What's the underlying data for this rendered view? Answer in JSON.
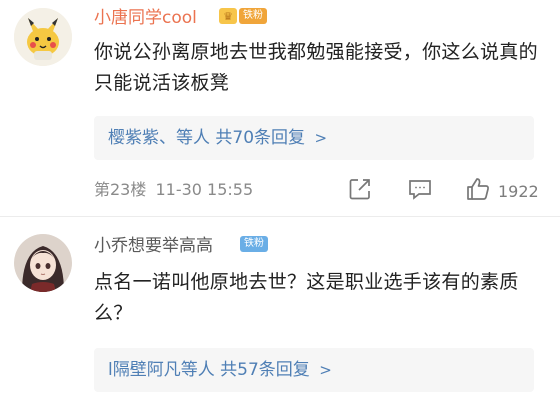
{
  "comments": [
    {
      "username": "小唐同学cool",
      "badge": "铁粉",
      "text": "你说公孙离原地去世我都勉强能接受，你这么说真的只能说活该板凳",
      "replies": {
        "names": "樱紫紫、等人",
        "count_text": "共70条回复",
        "arrow": ">"
      },
      "floor": "第23楼",
      "time": "11-30 15:55",
      "likes": "1922"
    },
    {
      "username": "小乔想要举高高",
      "badge": "铁粉",
      "text": "点名一诺叫他原地去世？这是职业选手该有的素质么？",
      "replies": {
        "names": "l隔壁阿凡等人",
        "count_text": "共57条回复",
        "arrow": ">"
      }
    }
  ],
  "icons": {
    "crown": "crown-icon",
    "share": "share-icon",
    "comment": "comment-icon",
    "like": "thumbs-up-icon"
  },
  "colors": {
    "username_vip": "#eb7350",
    "link": "#4f7fb5",
    "badge_orange": "#f0a53a",
    "badge_blue": "#6aaee6"
  }
}
